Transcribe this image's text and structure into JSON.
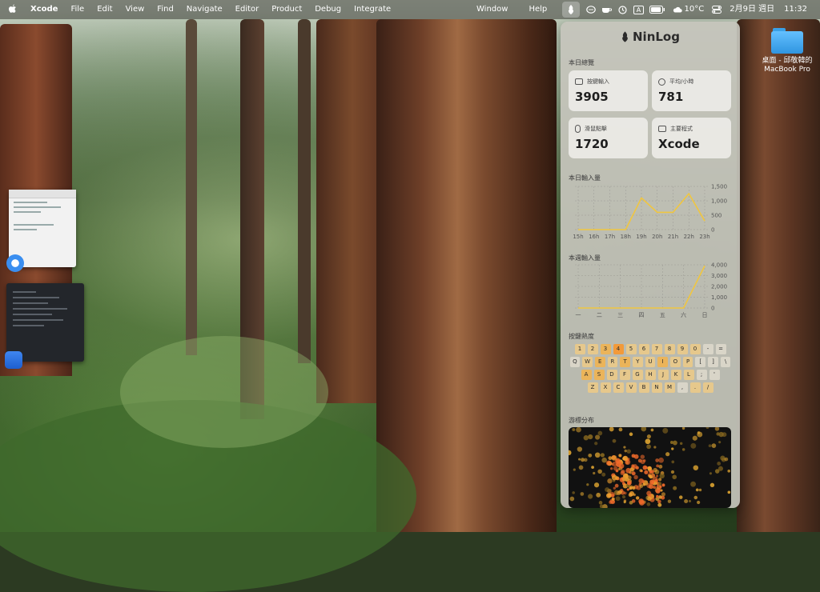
{
  "menubar": {
    "apple_icon": "apple-logo-icon",
    "app_name": "Xcode",
    "menus": [
      "File",
      "Edit",
      "View",
      "Find",
      "Navigate",
      "Editor",
      "Product",
      "Debug",
      "Integrate"
    ],
    "window_menu": "Window",
    "help_menu": "Help",
    "status_icons": [
      "ninlog-icon",
      "chat-icon",
      "coffee-icon",
      "clock-icon",
      "input-method-icon",
      "battery-icon"
    ],
    "input_method_letter": "A",
    "weather": "10°C",
    "date": "2月9日 週日",
    "time": "11:32"
  },
  "desktop": {
    "folder_label_line1": "桌面 - 邱敬韓的",
    "folder_label_line2": "MacBook Pro"
  },
  "panel": {
    "title": "NinLog",
    "today_overview_label": "本日總覽",
    "cards": [
      {
        "label": "按鍵輸入",
        "value": "3905",
        "icon": "keyboard-icon"
      },
      {
        "label": "平均/小時",
        "value": "781",
        "icon": "clock-icon"
      },
      {
        "label": "滑鼠點擊",
        "value": "1720",
        "icon": "mouse-icon"
      },
      {
        "label": "主要程式",
        "value": "Xcode",
        "icon": "window-icon"
      }
    ],
    "today_input_label": "本日輸入量",
    "week_input_label": "本週輸入量",
    "heatmap_label": "按鍵熱度",
    "cursor_label": "游標分布"
  },
  "chart_data": [
    {
      "type": "line",
      "title": "本日輸入量",
      "categories": [
        "15h",
        "16h",
        "17h",
        "18h",
        "19h",
        "20h",
        "21h",
        "22h",
        "23h"
      ],
      "values": [
        0,
        0,
        0,
        0,
        1100,
        600,
        600,
        1250,
        300
      ],
      "ylim": [
        0,
        1500
      ],
      "yticks": [
        "1,500",
        "1,000",
        "500",
        "0"
      ],
      "color": "#f0c640"
    },
    {
      "type": "line",
      "title": "本週輸入量",
      "categories": [
        "一",
        "二",
        "三",
        "四",
        "五",
        "六",
        "日"
      ],
      "values": [
        0,
        0,
        0,
        0,
        0,
        0,
        3905
      ],
      "ylim": [
        0,
        4000
      ],
      "yticks": [
        "4,000",
        "3,000",
        "2,000",
        "1,000",
        "0"
      ],
      "color": "#f0c640"
    }
  ],
  "keyboard": {
    "rows": [
      [
        [
          "1",
          1
        ],
        [
          "2",
          1
        ],
        [
          "3",
          2
        ],
        [
          "4",
          3
        ],
        [
          "5",
          1
        ],
        [
          "6",
          1
        ],
        [
          "7",
          1
        ],
        [
          "8",
          1
        ],
        [
          "9",
          1
        ],
        [
          "0",
          1
        ],
        [
          "-",
          0
        ],
        [
          "=",
          0
        ]
      ],
      [
        [
          "Q",
          0
        ],
        [
          "W",
          1
        ],
        [
          "E",
          2
        ],
        [
          "R",
          1
        ],
        [
          "T",
          2
        ],
        [
          "Y",
          1
        ],
        [
          "U",
          1
        ],
        [
          "I",
          2
        ],
        [
          "O",
          1
        ],
        [
          "P",
          1
        ],
        [
          "[",
          0
        ],
        [
          "]",
          0
        ],
        [
          "\\",
          0
        ]
      ],
      [
        [
          "A",
          2
        ],
        [
          "S",
          2
        ],
        [
          "D",
          1
        ],
        [
          "F",
          1
        ],
        [
          "G",
          1
        ],
        [
          "H",
          1
        ],
        [
          "J",
          1
        ],
        [
          "K",
          1
        ],
        [
          "L",
          1
        ],
        [
          ";",
          0
        ],
        [
          "'",
          0
        ]
      ],
      [
        [
          "Z",
          1
        ],
        [
          "X",
          1
        ],
        [
          "C",
          1
        ],
        [
          "V",
          1
        ],
        [
          "B",
          1
        ],
        [
          "N",
          1
        ],
        [
          "M",
          1
        ],
        [
          ",",
          0
        ],
        [
          ".",
          1
        ],
        [
          "/",
          1
        ]
      ]
    ],
    "colors": [
      "#d9d5c8",
      "#e6c88c",
      "#ebb45a",
      "#f29a3a"
    ]
  }
}
